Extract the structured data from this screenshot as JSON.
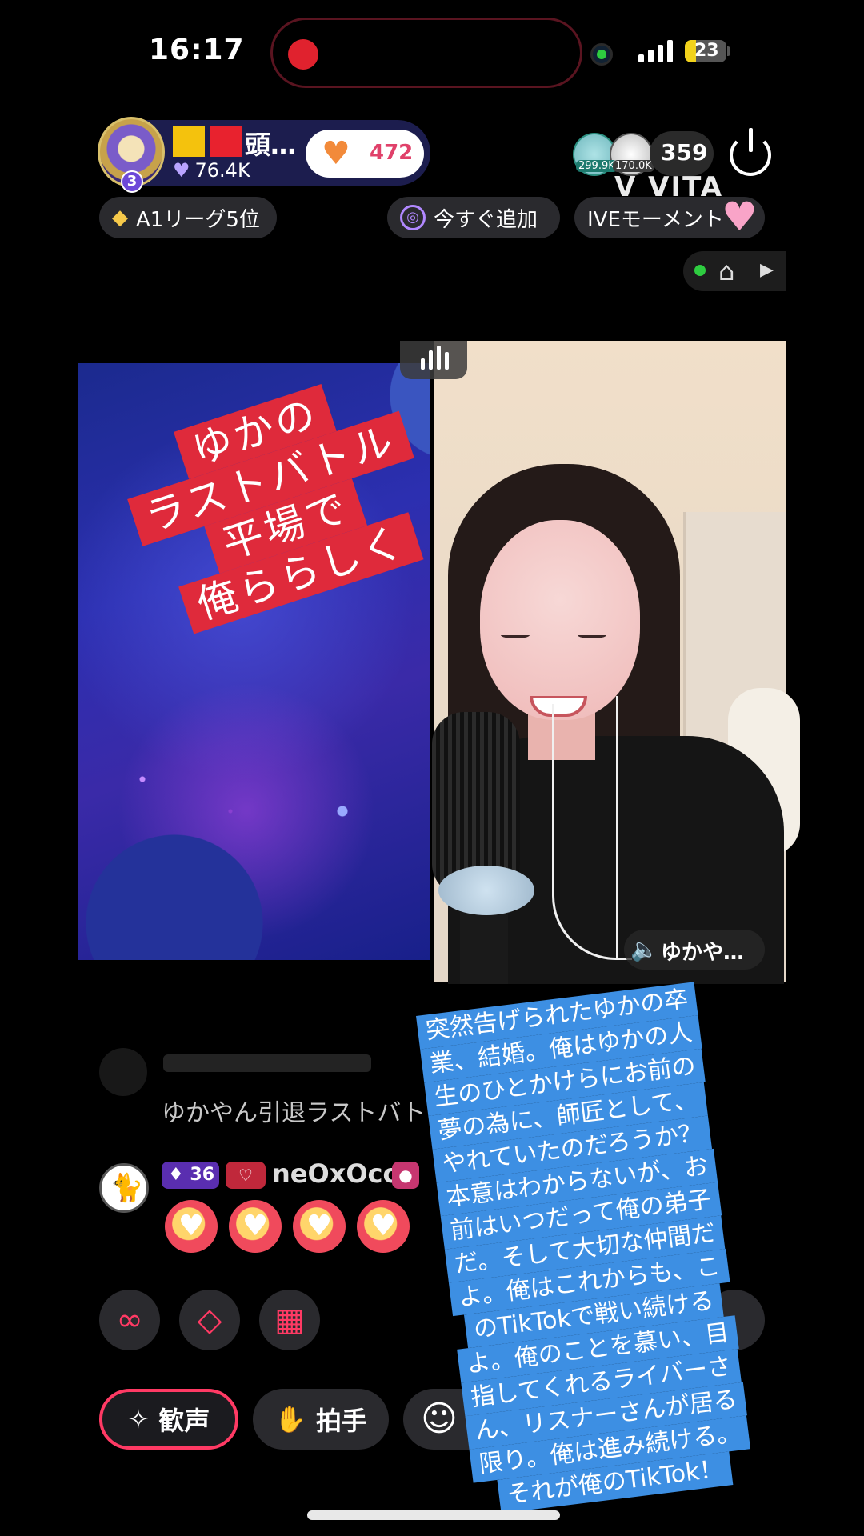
{
  "status_bar": {
    "time": "16:17",
    "battery": "23"
  },
  "host": {
    "name": "頭…",
    "likes": "76.4K",
    "gift_count": "472",
    "level": "3"
  },
  "viewers": {
    "top1_score": "299.9K",
    "top2_score": "170.0K",
    "count": "359"
  },
  "watermark": "VITA",
  "chips": {
    "league": "A1リーグ5位",
    "add_now": "今すぐ追加",
    "moment": "IVEモーメント"
  },
  "battle": {
    "speaker_name": "ゆかや…"
  },
  "title_overlay": [
    "ゆかの",
    "ラストバトル",
    "平場で",
    "俺ららしく"
  ],
  "chat": {
    "prev_message": "ゆかやん引退ラストバト",
    "level": "36",
    "user": "neOxOco"
  },
  "actions": {
    "cheer": "歓声",
    "clap": "拍手"
  },
  "message_overlay": [
    "突然告げられたゆかの卒",
    "業、結婚。俺はゆかの人",
    "生のひとかけらにお前の",
    "夢の為に、師匠として、",
    "やれていたのだろうか？",
    "本意はわからないが、お",
    "前はいつだって俺の弟子",
    "だ。そして大切な仲間だ",
    "よ。俺はこれからも、こ",
    "のTikTokで戦い続ける",
    "よ。俺のことを慕い、目",
    "指してくれるライバーさ",
    "ん、リスナーさんが居る",
    "限り。俺は進み続ける。",
    "それが俺のTikTok！"
  ]
}
